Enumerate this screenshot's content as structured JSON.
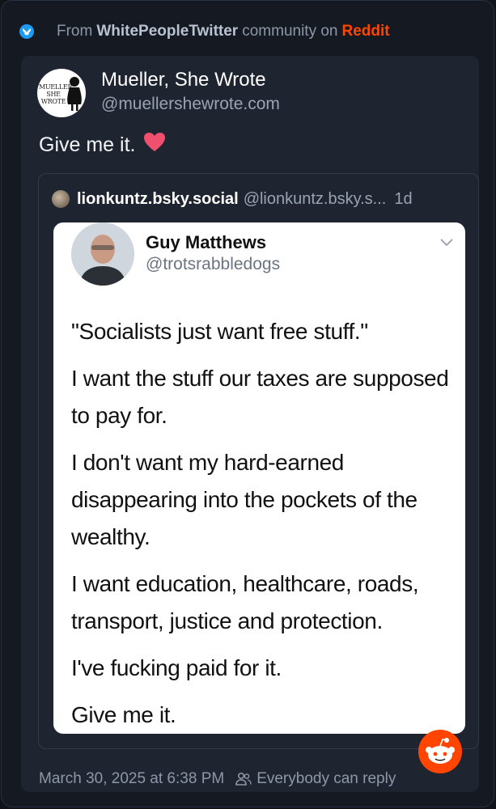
{
  "header": {
    "prefix": "From",
    "community": "WhitePeopleTwitter",
    "middle": "community on",
    "platform": "Reddit"
  },
  "post": {
    "author_name": "Mueller, She Wrote",
    "author_handle": "@muellershewrote.com",
    "avatar_text": "MUELLER SHE WROTE",
    "text": "Give me it.",
    "emoji": "red-heart-icon",
    "timestamp": "March 30, 2025 at 6:38 PM",
    "reply_setting": "Everybody can reply"
  },
  "quote": {
    "name": "lionkuntz.bsky.social",
    "handle": "@lionkuntz.bsky.s...",
    "time": "1d"
  },
  "embedded_tweet": {
    "name": "Guy Matthews",
    "handle": "@trotsrabbledogs",
    "paragraphs": [
      "\"Socialists just want free stuff.\"",
      "I want the stuff our taxes are supposed to pay for.",
      "I don't want my hard-earned disappearing into the pockets of the wealthy.",
      "I want education, healthcare, roads, transport, justice and protection.",
      "I've fucking paid for it.",
      "Give me it."
    ]
  },
  "colors": {
    "background": "#151a22",
    "card": "#1f2530",
    "reddit_accent": "#ff4500",
    "bluesky_badge": "#1d9bf0"
  }
}
